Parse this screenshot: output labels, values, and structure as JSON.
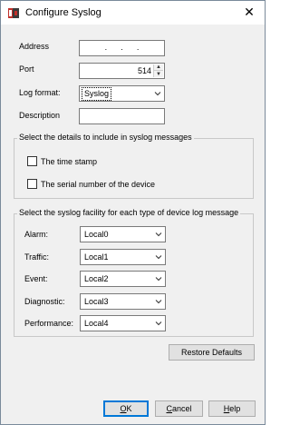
{
  "window": {
    "title": "Configure Syslog",
    "icon": "watchguard-app-icon",
    "close_icon": "close-icon"
  },
  "form": {
    "address_label": "Address",
    "address_value": ". . .",
    "port_label": "Port",
    "port_value": "514",
    "log_format_label": "Log format:",
    "log_format_value": "Syslog",
    "description_label": "Description",
    "description_value": ""
  },
  "details_group": {
    "title": "Select the details to include in syslog messages",
    "timestamp_label": "The time stamp",
    "timestamp_checked": false,
    "serial_label": "The serial number of the device",
    "serial_checked": false
  },
  "facility_group": {
    "title": "Select the syslog facility for each type of device log message",
    "rows": [
      {
        "label": "Alarm:",
        "value": "Local0"
      },
      {
        "label": "Traffic:",
        "value": "Local1"
      },
      {
        "label": "Event:",
        "value": "Local2"
      },
      {
        "label": "Diagnostic:",
        "value": "Local3"
      },
      {
        "label": "Performance:",
        "value": "Local4"
      }
    ]
  },
  "buttons": {
    "restore_defaults": "Restore Defaults",
    "ok_first": "O",
    "ok_rest": "K",
    "cancel_first": "C",
    "cancel_rest": "ancel",
    "help_first": "H",
    "help_rest": "elp"
  },
  "colors": {
    "window_bg": "#f0f0f0",
    "focus_border": "#0078d7"
  }
}
